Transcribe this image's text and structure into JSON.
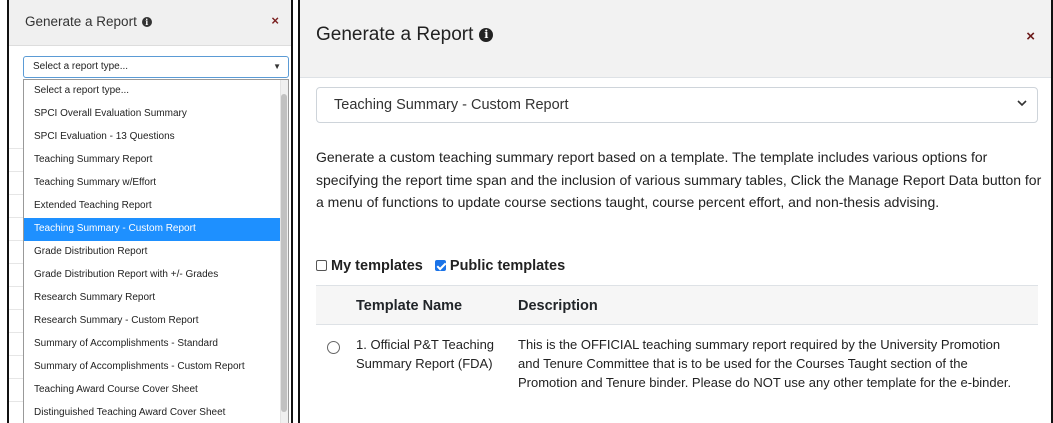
{
  "left_modal": {
    "title": "Generate a Report",
    "info_glyph": "i",
    "close_glyph": "×",
    "select_value": "Select a report type...",
    "select_caret": "▼",
    "options": [
      "Select a report type...",
      "SPCI Overall Evaluation Summary",
      "SPCI Evaluation - 13 Questions",
      "Teaching Summary Report",
      "Teaching Summary w/Effort",
      "Extended Teaching Report",
      "Teaching Summary - Custom Report",
      "Grade Distribution Report",
      "Grade Distribution Report with +/- Grades",
      "Research Summary Report",
      "Research Summary - Custom Report",
      "Summary of Accomplishments - Standard",
      "Summary of Accomplishments - Custom Report",
      "Teaching Award Course Cover Sheet",
      "Distinguished Teaching Award Cover Sheet"
    ],
    "selected_option": "Teaching Summary - Custom Report"
  },
  "right_modal": {
    "title": "Generate a Report",
    "info_glyph": "i",
    "close_glyph": "×",
    "report_type_value": "Teaching Summary - Custom Report",
    "description": "Generate a custom teaching summary report based on a template. The template includes various options for specifying the report time span and the inclusion of various summary tables, Click the Manage Report Data button for a menu of functions to update course sections taught, course percent effort, and non-thesis advising.",
    "filters": {
      "my_templates_label": "My templates",
      "my_templates_checked": false,
      "public_templates_label": "Public templates",
      "public_templates_checked": true
    },
    "table": {
      "headers": {
        "name": "Template Name",
        "description": "Description"
      },
      "rows": [
        {
          "name": "1. Official P&T Teaching Summary Report (FDA)",
          "description": "This is the OFFICIAL teaching summary report required by the University Promotion and Tenure Committee that is to be used for the Courses Taught section of the Promotion and Tenure binder. Please do NOT use any other template for the e-binder."
        }
      ]
    }
  },
  "icons": {
    "info": "info-icon",
    "close": "close-icon",
    "dropdown": "chevron-down-icon"
  },
  "colors": {
    "selected_option_bg": "#1e90ff",
    "checkbox_checked": "#1a73e8",
    "close_x": "#6b1a1a"
  }
}
